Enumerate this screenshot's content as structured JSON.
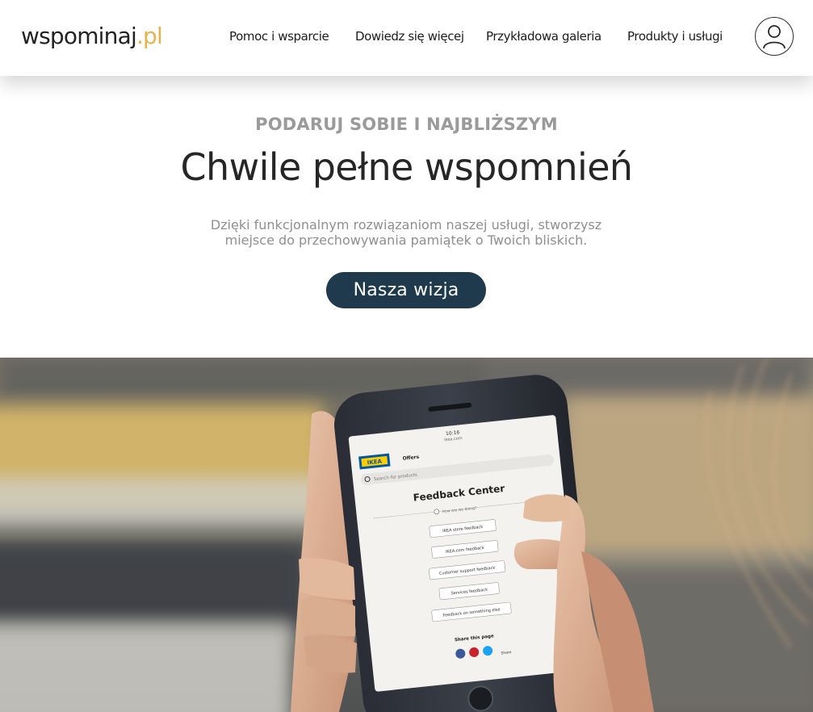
{
  "brand": {
    "name_main": "wspominaj",
    "name_accent": ".pl",
    "accent_color": "#e7b24a"
  },
  "nav": [
    {
      "label": "Pomoc i wsparcie"
    },
    {
      "label": "Dowiedz się więcej"
    },
    {
      "label": "Przykładowa galeria"
    },
    {
      "label": "Produkty i usługi"
    }
  ],
  "account": {
    "icon": "user-icon"
  },
  "hero": {
    "eyebrow": "PODARUJ SOBIE I NAJBLIŻSZYM",
    "title": "Chwile pełne wspomnień",
    "description": "Dzięki funkcjonalnym rozwiązaniom naszej usługi, stworzysz miejsce do przechowywania pamiątek o Twoich bliskich.",
    "cta_label": "Nasza wizja",
    "cta_color": "#1f3a4d"
  },
  "phone_screen": {
    "time": "10:16",
    "url": "ikea.com",
    "brand": "IKEA",
    "tab": "Offers",
    "search_placeholder": "Search for products",
    "heading": "Feedback Center",
    "subheading": "How are we doing?",
    "buttons": [
      "IKEA store feedback",
      "IKEA.com feedback",
      "Customer support feedback",
      "Services feedback",
      "Feedback on something else"
    ],
    "share_label": "Share this page",
    "share_text": "Share"
  }
}
